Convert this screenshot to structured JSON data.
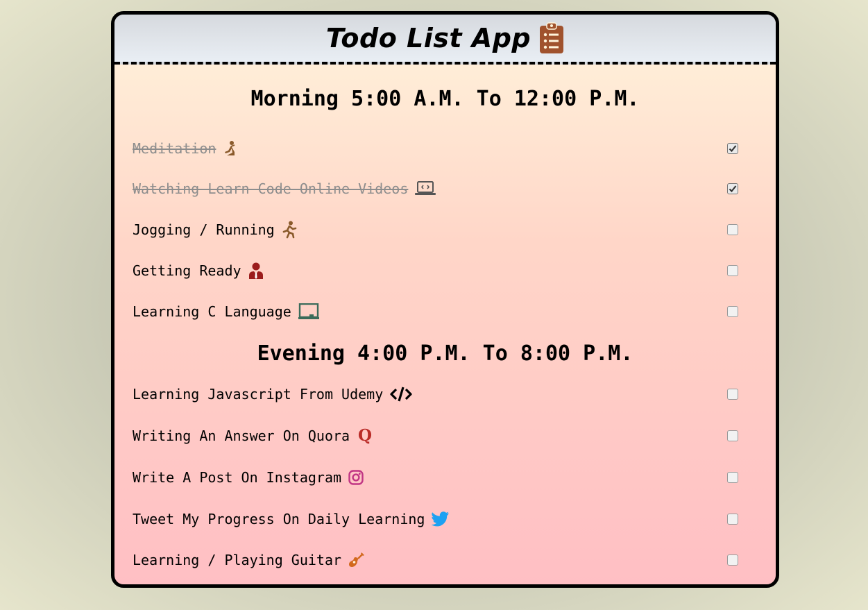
{
  "app": {
    "title": "Todo List App",
    "title_icon": "clipboard-list-icon"
  },
  "morning": {
    "title": "Morning 5:00 A.M. To 12:00 P.M.",
    "items": [
      {
        "label": "Meditation",
        "icon": "meditation-icon",
        "checked": true
      },
      {
        "label": "Watching Learn Code Online Videos",
        "icon": "laptop-code-icon",
        "checked": true
      },
      {
        "label": "Jogging / Running",
        "icon": "running-icon",
        "checked": false
      },
      {
        "label": "Getting Ready",
        "icon": "user-tie-icon",
        "checked": false
      },
      {
        "label": "Learning C Language",
        "icon": "chalkboard-icon",
        "checked": false
      }
    ]
  },
  "evening": {
    "title": "Evening 4:00 P.M. To 8:00 P.M.",
    "items": [
      {
        "label": "Learning Javascript From Udemy",
        "icon": "code-icon",
        "checked": false
      },
      {
        "label": "Writing An Answer On Quora",
        "icon": "quora-icon",
        "checked": false
      },
      {
        "label": "Write A Post On Instagram",
        "icon": "instagram-icon",
        "checked": false
      },
      {
        "label": "Tweet My Progress On Daily Learning",
        "icon": "twitter-icon",
        "checked": false
      },
      {
        "label": "Learning / Playing Guitar",
        "icon": "guitar-icon",
        "checked": false
      }
    ]
  },
  "colors": {
    "border": "#000000",
    "done_text": "#8d8d8d",
    "clipboard": "#a0522d",
    "quora": "#b92b27",
    "instagram": "#c13584",
    "twitter": "#1da1f2",
    "guitar": "#d2691e"
  }
}
